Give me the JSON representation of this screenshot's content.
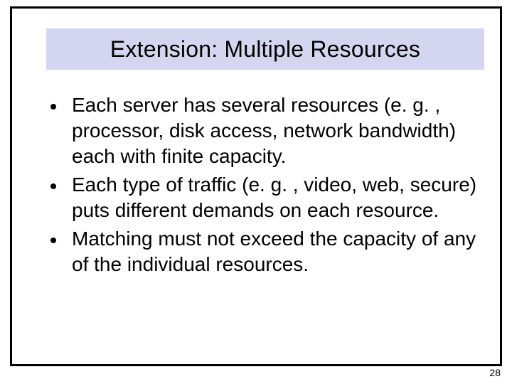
{
  "slide": {
    "title": "Extension: Multiple Resources",
    "bullets": [
      "Each server has several resources (e. g. , processor, disk access, network bandwidth) each with finite capacity.",
      "Each type of traffic (e. g. , video, web, secure) puts different demands on each resource.",
      "Matching must not exceed the capacity of any of the individual resources."
    ],
    "page_number": "28"
  }
}
